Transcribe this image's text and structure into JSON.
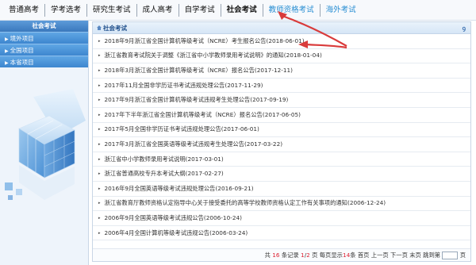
{
  "topnav": {
    "tabs": [
      {
        "label": "普通高考",
        "state": "active"
      },
      {
        "label": "学考选考",
        "state": "normal"
      },
      {
        "label": "研究生考试",
        "state": "normal"
      },
      {
        "label": "成人高考",
        "state": "normal"
      },
      {
        "label": "自学考试",
        "state": "normal"
      },
      {
        "label": "社会考试",
        "state": "current"
      },
      {
        "label": "教师资格考试",
        "state": "muted"
      },
      {
        "label": "海外考试",
        "state": "muted"
      }
    ]
  },
  "sidebar": {
    "title": "社会考试",
    "items": [
      {
        "label": "境外项目"
      },
      {
        "label": "全国项目"
      },
      {
        "label": "本省项目"
      }
    ]
  },
  "panel": {
    "title": "社会考试",
    "right_glyph": "ꝯ"
  },
  "items": [
    {
      "text": "2018年9月浙江省全国计算机等级考试（NCRE）考生报名公告(2018-06-01)"
    },
    {
      "text": "浙江省教育考试院关于调整《浙江省中小学教师录用考试说明》的通知(2018-01-04)"
    },
    {
      "text": "2018年3月浙江省全国计算机等级考试（NCRE）报名公告(2017-12-11)"
    },
    {
      "text": "2017年11月全国非学历证书考试违规处理公告(2017-11-29)"
    },
    {
      "text": "2017年9月浙江省全国计算机等级考试违规考生处理公告(2017-09-19)"
    },
    {
      "text": "2017年下半年浙江省全国计算机等级考试（NCRE）报名公告(2017-06-05)"
    },
    {
      "text": "2017年5月全国非学历证书考试违规处理公告(2017-06-01)"
    },
    {
      "text": "2017年3月浙江省全国英语等级考试违规考生处理公告(2017-03-22)"
    },
    {
      "text": "浙江省中小学教师录用考试说明(2017-03-01)"
    },
    {
      "text": "浙江省普通高校专升本考试大纲(2017-02-27)"
    },
    {
      "text": "2016年9月全国英语等级考试违规处理公告(2016-09-21)"
    },
    {
      "text": "浙江省教育厅教师资格认定指导中心关于接受委托的高等学校教师资格认定工作有关事项的通知(2006-12-24)"
    },
    {
      "text": "2006年9月全国英语等级考试违规公告(2006-10-24)"
    },
    {
      "text": "2006年4月全国计算机等级考试违规公告(2006-03-24)"
    }
  ],
  "pager": {
    "prefix": "共",
    "total": "16",
    "records_label": "条记录",
    "current_page": "1",
    "slash": "/",
    "total_pages": "2",
    "page_label": "页",
    "per_page_prefix": "每页显示",
    "per_page": "14",
    "per_page_suffix": "条",
    "first": "首页",
    "prev": "上一页",
    "next": "下一页",
    "last": "末页",
    "jump": "跳到第",
    "jump_suffix": "页",
    "jump_value": ""
  },
  "colors": {
    "accent": "#3d86cf",
    "annotation": "#d93b3b",
    "link_blue": "#1f6fc2"
  },
  "icons": {
    "bullet": "▸",
    "sidebar_arrow": "▶"
  }
}
